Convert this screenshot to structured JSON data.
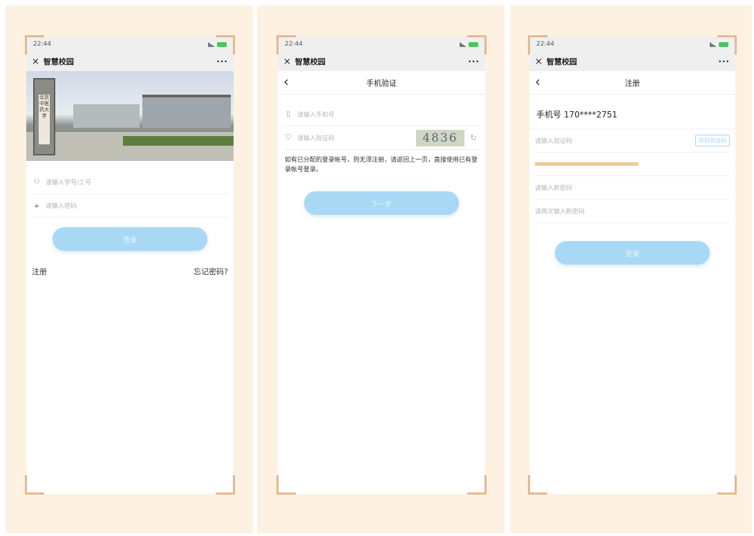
{
  "status": {
    "time": "22:44"
  },
  "app": {
    "title": "智慧校园",
    "close_glyph": "×",
    "more_glyph": "···"
  },
  "screen1": {
    "hero_plaque": "北京中医药大学",
    "username_placeholder": "请输入学号/工号",
    "password_placeholder": "请输入密码",
    "login_label": "登录",
    "register_link": "注册",
    "forgot_link": "忘记密码?"
  },
  "screen2": {
    "nav_title": "手机验证",
    "back_glyph": "‹",
    "phone_placeholder": "请输入手机号",
    "code_placeholder": "请输入验证码",
    "captcha": "4836",
    "notice": "如有已分配的登录帐号，则无须注册，请返回上一页，直接使用已有登录帐号登录。",
    "next_label": "下一步"
  },
  "screen3": {
    "nav_title": "注册",
    "back_glyph": "‹",
    "phone_display": "手机号 170****2751",
    "code_placeholder": "请输入验证码",
    "get_code_label": "获取验证码",
    "new_password_placeholder": "请输入新密码",
    "confirm_password_placeholder": "请再次输入新密码",
    "submit_label": "登录"
  },
  "colors": {
    "background": "#fdf1e2",
    "accent_button": "#a8d8f4",
    "corner_bracket": "#e4b88f",
    "tip_text": "#e5a35a"
  }
}
